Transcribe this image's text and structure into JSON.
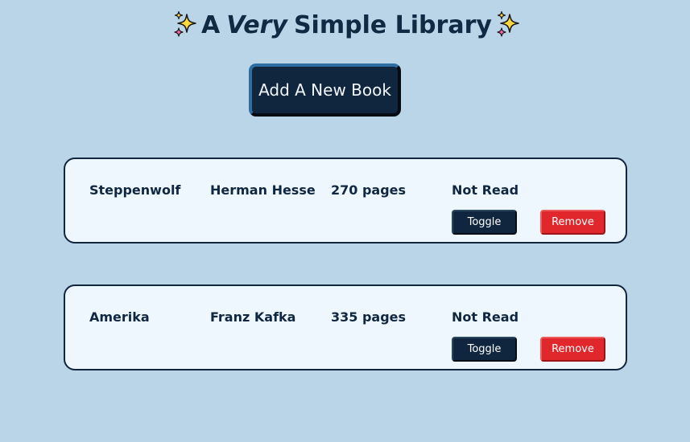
{
  "header": {
    "title_prefix": "A",
    "title_emphasis": "Very",
    "title_suffix": "Simple Library",
    "sparkle_icon": "sparkles-icon"
  },
  "add_button": {
    "label": "Add A New Book"
  },
  "books": [
    {
      "title": "Steppenwolf",
      "author": "Herman Hesse",
      "pages": "270 pages",
      "status": "Not Read",
      "toggle_label": "Toggle",
      "remove_label": "Remove"
    },
    {
      "title": "Amerika",
      "author": "Franz Kafka",
      "pages": "335 pages",
      "status": "Not Read",
      "toggle_label": "Toggle",
      "remove_label": "Remove"
    }
  ],
  "colors": {
    "background": "#bad4e8",
    "primary": "#10263e",
    "danger": "#e0282c",
    "card": "#eff7fe"
  }
}
